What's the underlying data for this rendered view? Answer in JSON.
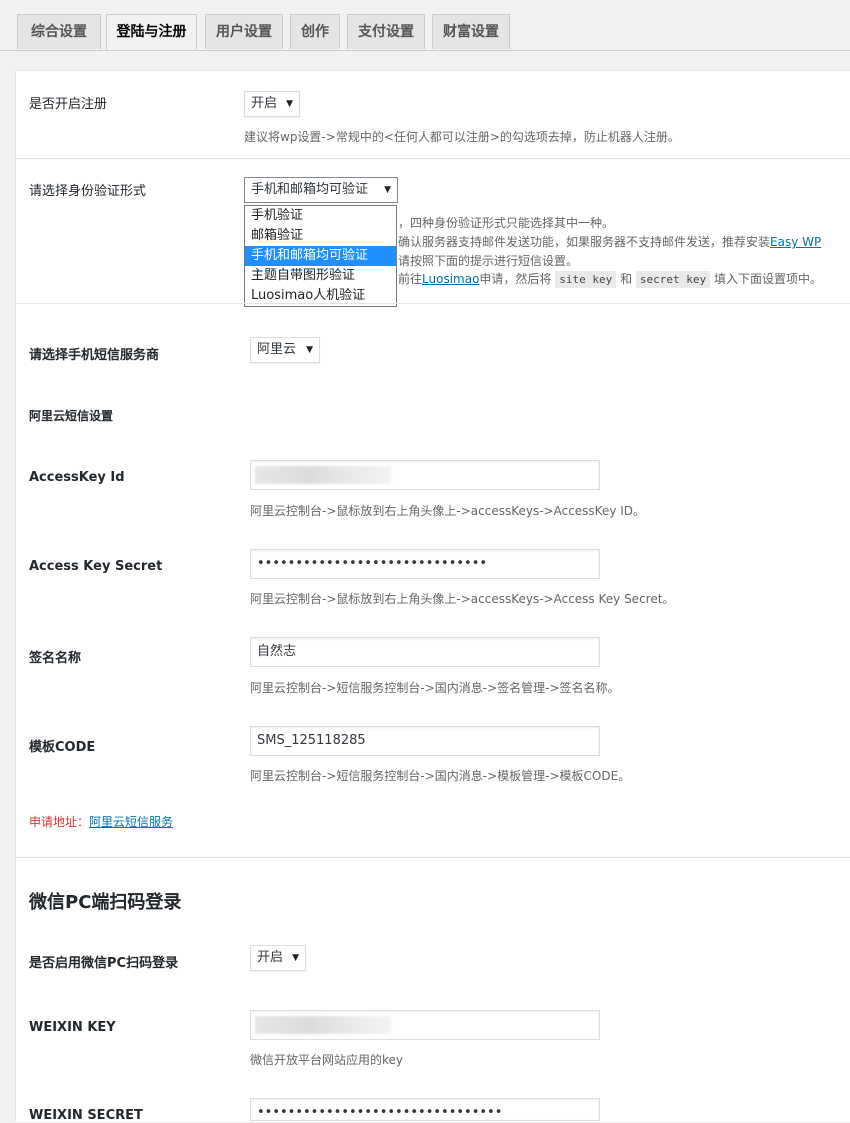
{
  "tabs": [
    "综合设置",
    "登陆与注册",
    "用户设置",
    "创作",
    "支付设置",
    "财富设置"
  ],
  "register": {
    "label": "是否开启注册",
    "value": "开启",
    "hint": "建议将wp设置->常规中的<任何人都可以注册>的勾选项去掉，防止机器人注册。"
  },
  "verify": {
    "label": "请选择身份验证形式",
    "value": "手机和邮箱均可验证",
    "options": [
      "手机验证",
      "邮箱验证",
      "手机和邮箱均可验证",
      "主题自带图形验证",
      "Luosimao人机验证"
    ],
    "hint1": "，四种身份验证形式只能选择其中一种。",
    "hint2": "确认服务器支持邮件发送功能，如果服务器不支持邮件发送，推荐安装",
    "hint2_link": "Easy WP",
    "hint3": "请按照下面的提示进行短信设置。",
    "hint4_pre": "前往",
    "hint4_link": "Luosimao",
    "hint4_mid": "申请，然后将",
    "hint4_code1": "site key",
    "hint4_and": "和",
    "hint4_code2": "secret key",
    "hint4_post": "填入下面设置项中。"
  },
  "sms": {
    "provider_label": "请选择手机短信服务商",
    "provider_value": "阿里云",
    "subheading": "阿里云短信设置",
    "access_key_id": {
      "label": "AccessKey Id",
      "hint": "阿里云控制台->鼠标放到右上角头像上->accessKeys->AccessKey ID。"
    },
    "access_key_secret": {
      "label": "Access Key Secret",
      "value": "••••••••••••••••••••••••••••••",
      "hint": "阿里云控制台->鼠标放到右上角头像上->accessKeys->Access Key Secret。"
    },
    "sign_name": {
      "label": "签名名称",
      "value": "自然志",
      "hint": "阿里云控制台->短信服务控制台->国内消息->签名管理->签名名称。"
    },
    "template_code": {
      "label": "模板CODE",
      "value": "SMS_125118285",
      "hint": "阿里云控制台->短信服务控制台->国内消息->模板管理->模板CODE。"
    },
    "apply_label": "申请地址：",
    "apply_link": "阿里云短信服务"
  },
  "wechat": {
    "title": "微信PC端扫码登录",
    "enable_label": "是否启用微信PC扫码登录",
    "enable_value": "开启",
    "key_label": "WEIXIN KEY",
    "key_hint": "微信开放平台网站应用的key",
    "secret_label": "WEIXIN SECRET",
    "secret_value": "••••••••••••••••••••••••••••••••"
  },
  "colors": {
    "link": "#0073aa",
    "highlight": "#1e90ff",
    "warning": "#dc3232"
  }
}
